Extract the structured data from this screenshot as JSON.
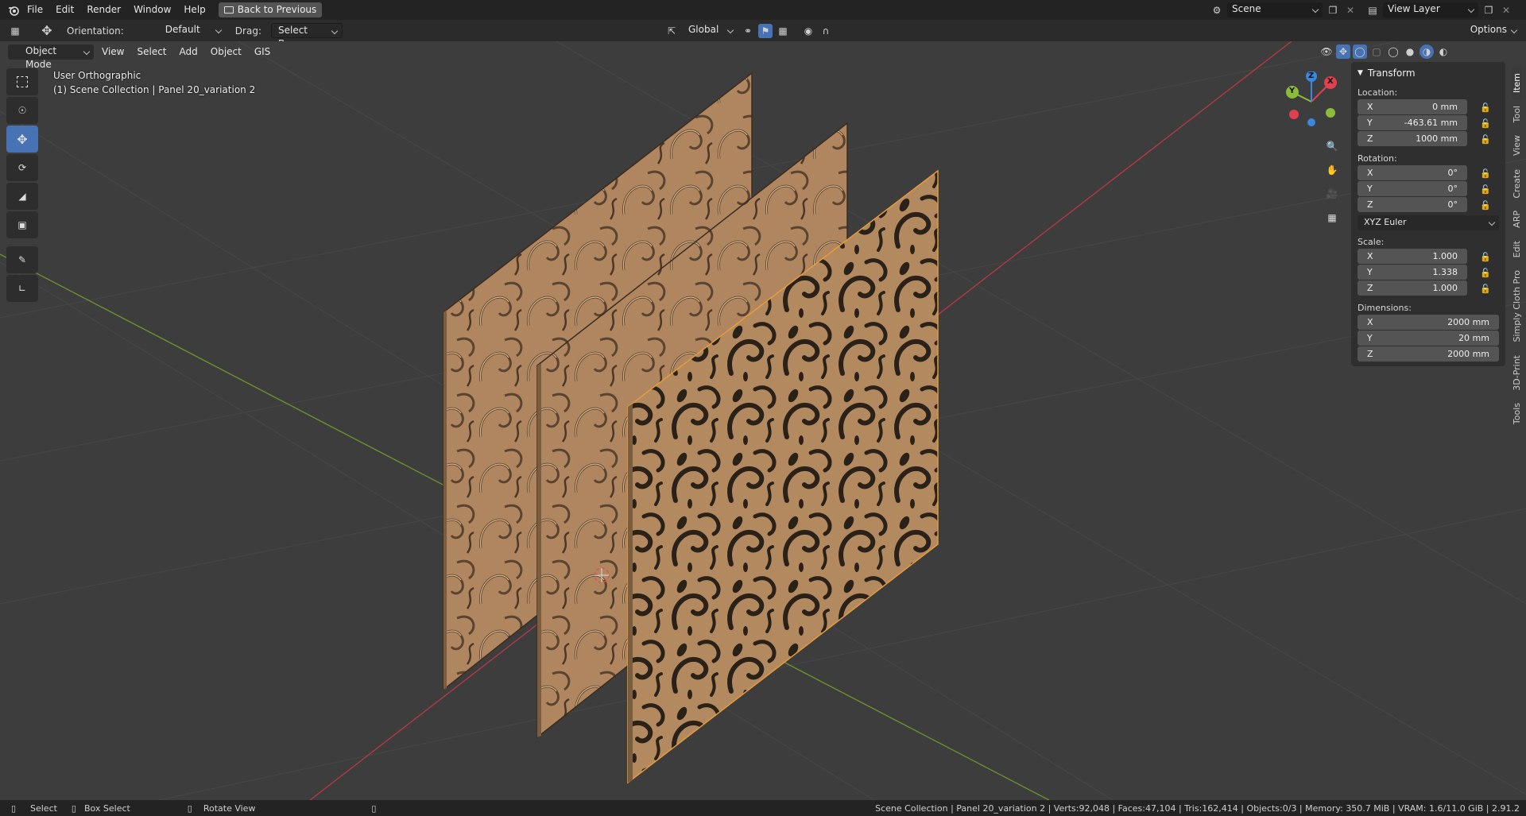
{
  "topbar": {
    "menus": [
      "File",
      "Edit",
      "Render",
      "Window",
      "Help"
    ],
    "back_button": "Back to Previous",
    "scene": "Scene",
    "view_layer": "View Layer"
  },
  "toolheader": {
    "orientation_label": "Orientation:",
    "orientation_value": "Default",
    "drag_label": "Drag:",
    "drag_value": "Select Box",
    "transform_orientation": "Global",
    "options": "Options"
  },
  "viewport_header": {
    "mode": "Object Mode",
    "menus": [
      "View",
      "Select",
      "Add",
      "Object",
      "GIS"
    ]
  },
  "overlay": {
    "view_name": "User Orthographic",
    "collection": "(1) Scene Collection | Panel 20_variation 2"
  },
  "gizmo": {
    "x": "X",
    "y": "Y",
    "z": "Z",
    "colors": {
      "x": "#e0404f",
      "y": "#8bbc3c",
      "z": "#3c86e0"
    }
  },
  "npanel": {
    "title": "Transform",
    "location_label": "Location:",
    "location": [
      {
        "axis": "X",
        "value": "0 mm"
      },
      {
        "axis": "Y",
        "value": "-463.61 mm"
      },
      {
        "axis": "Z",
        "value": "1000 mm"
      }
    ],
    "rotation_label": "Rotation:",
    "rotation": [
      {
        "axis": "X",
        "value": "0°"
      },
      {
        "axis": "Y",
        "value": "0°"
      },
      {
        "axis": "Z",
        "value": "0°"
      }
    ],
    "rotation_mode": "XYZ Euler",
    "scale_label": "Scale:",
    "scale": [
      {
        "axis": "X",
        "value": "1.000"
      },
      {
        "axis": "Y",
        "value": "1.338"
      },
      {
        "axis": "Z",
        "value": "1.000"
      }
    ],
    "dimensions_label": "Dimensions:",
    "dimensions": [
      {
        "axis": "X",
        "value": "2000 mm"
      },
      {
        "axis": "Y",
        "value": "20 mm"
      },
      {
        "axis": "Z",
        "value": "2000 mm"
      }
    ]
  },
  "side_tabs": [
    "Item",
    "Tool",
    "View",
    "Create",
    "ARP",
    "Edit",
    "Simply Cloth Pro",
    "3D-Print",
    "Tools"
  ],
  "statusbar": {
    "select": "Select",
    "box_select": "Box Select",
    "rotate_view": "Rotate View",
    "stats": "Scene Collection | Panel 20_variation 2 | Verts:92,048 | Faces:47,104 | Tris:162,414 | Objects:0/3 | Memory: 350.7 MiB | VRAM: 1.6/11.0 GiB | 2.91.2"
  },
  "colors": {
    "accent": "#4772b3",
    "panel_wood": "#b38a5f",
    "pattern_dark": "#2a2118"
  }
}
